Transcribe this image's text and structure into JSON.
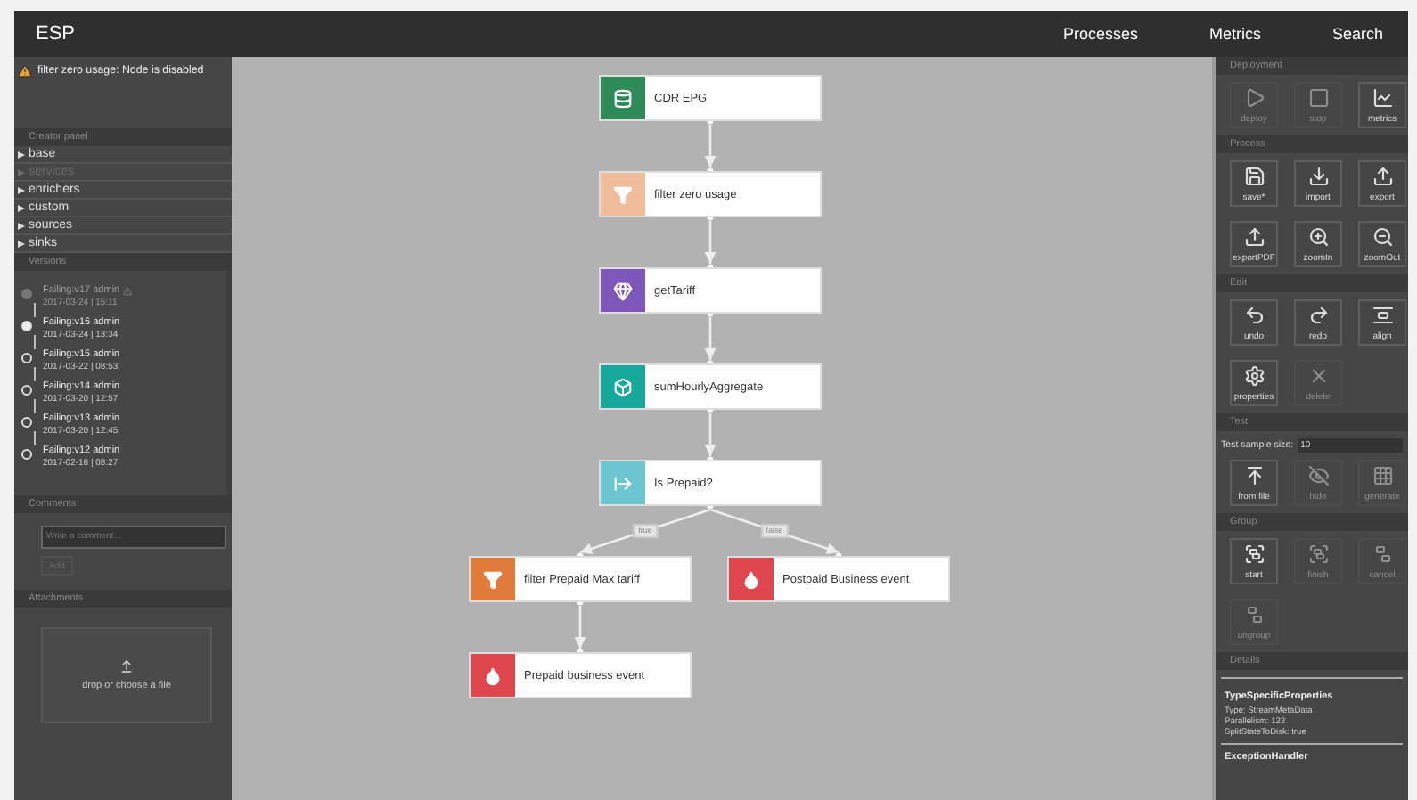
{
  "app": {
    "title": "ESP",
    "nav": [
      "Processes",
      "Metrics",
      "Search"
    ]
  },
  "left_panel": {
    "warning": "filter zero usage: Node is disabled",
    "creator_panel": {
      "title": "Creator panel",
      "categories": [
        {
          "label": "base",
          "disabled": false
        },
        {
          "label": "services",
          "disabled": true
        },
        {
          "label": "enrichers",
          "disabled": false
        },
        {
          "label": "custom",
          "disabled": false
        },
        {
          "label": "sources",
          "disabled": false
        },
        {
          "label": "sinks",
          "disabled": false
        }
      ]
    },
    "versions": {
      "title": "Versions",
      "items": [
        {
          "title": "Failing:v17 admin",
          "date": "2017-03-24 | 15:11",
          "selected": false,
          "latest": true,
          "warning": true
        },
        {
          "title": "Failing:v16 admin",
          "date": "2017-03-24 | 13:34",
          "selected": true,
          "latest": false,
          "warning": false
        },
        {
          "title": "Failing:v15 admin",
          "date": "2017-03-22 | 08:53",
          "selected": false,
          "latest": false,
          "warning": false
        },
        {
          "title": "Failing:v14 admin",
          "date": "2017-03-20 | 12:57",
          "selected": false,
          "latest": false,
          "warning": false
        },
        {
          "title": "Failing:v13 admin",
          "date": "2017-03-20 | 12:45",
          "selected": false,
          "latest": false,
          "warning": false
        },
        {
          "title": "Failing:v12 admin",
          "date": "2017-02-16 | 08:27",
          "selected": false,
          "latest": false,
          "warning": false
        }
      ]
    },
    "comments": {
      "title": "Comments",
      "placeholder": "Write a comment...",
      "button": {
        "label": "Add",
        "disabled": true
      }
    },
    "attachments": {
      "title": "Attachments",
      "dropzone": "drop or choose a file"
    }
  },
  "graph": {
    "nodes": [
      {
        "label": "CDR EPG",
        "kind": "source",
        "color": "#2e8b57"
      },
      {
        "label": "filter zero usage",
        "kind": "filter",
        "color": "#efbd9c"
      },
      {
        "label": "getTariff",
        "kind": "enricher",
        "color": "#7e57b8"
      },
      {
        "label": "sumHourlyAggregate",
        "kind": "custom",
        "color": "#16a89b"
      },
      {
        "label": "Is Prepaid?",
        "kind": "switch",
        "color": "#6cc6cf"
      },
      {
        "label": "filter Prepaid Max tariff",
        "kind": "filter",
        "color": "#e07b39"
      },
      {
        "label": "Postpaid Business event",
        "kind": "sink",
        "color": "#e0464d"
      },
      {
        "label": "Prepaid business event",
        "kind": "sink",
        "color": "#e0464d"
      }
    ],
    "branch_labels": [
      "true",
      "false"
    ]
  },
  "right_panel": {
    "sections": [
      {
        "title": "Deployment",
        "buttons": [
          {
            "label": "deploy",
            "kind": "play",
            "disabled": true
          },
          {
            "label": "stop",
            "kind": "stop",
            "disabled": true
          },
          {
            "label": "metrics",
            "kind": "chart",
            "disabled": false
          }
        ]
      },
      {
        "title": "Process",
        "buttons": [
          {
            "label": "save*",
            "kind": "save",
            "disabled": false
          },
          {
            "label": "import",
            "kind": "import",
            "disabled": false
          },
          {
            "label": "export",
            "kind": "export",
            "disabled": false
          },
          {
            "label": "exportPDF",
            "kind": "export",
            "disabled": false
          },
          {
            "label": "zoomIn",
            "kind": "zoomin",
            "disabled": false
          },
          {
            "label": "zoomOut",
            "kind": "zoomout",
            "disabled": false
          }
        ]
      },
      {
        "title": "Edit",
        "buttons": [
          {
            "label": "undo",
            "kind": "undo",
            "disabled": false
          },
          {
            "label": "redo",
            "kind": "redo",
            "disabled": false
          },
          {
            "label": "align",
            "kind": "align",
            "disabled": false
          },
          {
            "label": "properties",
            "kind": "gear",
            "disabled": false
          },
          {
            "label": "delete",
            "kind": "delete",
            "disabled": true
          }
        ]
      },
      {
        "title": "Test",
        "field": {
          "label": "Test sample size:",
          "value": "10"
        },
        "buttons": [
          {
            "label": "from file",
            "kind": "fromfile",
            "disabled": false
          },
          {
            "label": "hide",
            "kind": "hide",
            "disabled": true
          },
          {
            "label": "generate",
            "kind": "grid",
            "disabled": true
          }
        ]
      },
      {
        "title": "Group",
        "buttons": [
          {
            "label": "start",
            "kind": "group",
            "disabled": false
          },
          {
            "label": "finish",
            "kind": "group",
            "disabled": true
          },
          {
            "label": "cancel",
            "kind": "ungroup",
            "disabled": true
          },
          {
            "label": "ungroup",
            "kind": "ungroup",
            "disabled": true
          }
        ]
      }
    ],
    "details": {
      "title": "Details",
      "heading": "TypeSpecificProperties",
      "lines": [
        "Type: StreamMetaData",
        "Parallelism: 123",
        "SplitStateToDisk: true"
      ],
      "footer": "ExceptionHandler"
    }
  }
}
